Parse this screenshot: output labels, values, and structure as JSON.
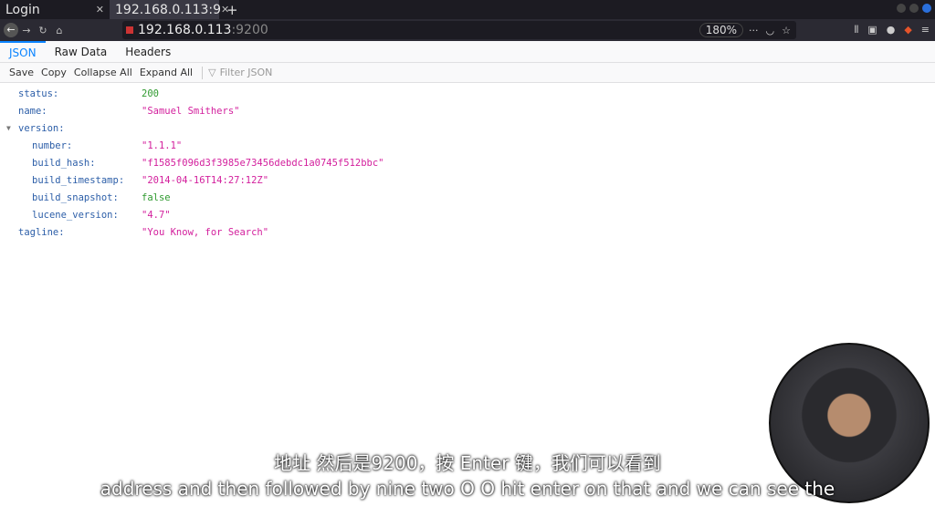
{
  "tabs": [
    {
      "label": "Login"
    },
    {
      "label": "192.168.0.113:9"
    }
  ],
  "new_tab": "+",
  "url": {
    "host": "192.168.0.113",
    "port": ":9200"
  },
  "zoom": "180%",
  "viewer_tabs": [
    "JSON",
    "Raw Data",
    "Headers"
  ],
  "toolbar": {
    "save": "Save",
    "copy": "Copy",
    "collapse": "Collapse All",
    "expand": "Expand All",
    "filter_placeholder": "Filter JSON"
  },
  "json": {
    "status": {
      "key": "status:",
      "value": "200"
    },
    "name": {
      "key": "name:",
      "value": "\"Samuel Smithers\""
    },
    "version": {
      "key": "version:"
    },
    "number": {
      "key": "number:",
      "value": "\"1.1.1\""
    },
    "build_hash": {
      "key": "build_hash:",
      "value": "\"f1585f096d3f3985e73456debdc1a0745f512bbc\""
    },
    "build_timestamp": {
      "key": "build_timestamp:",
      "value": "\"2014-04-16T14:27:12Z\""
    },
    "build_snapshot": {
      "key": "build_snapshot:",
      "value": "false"
    },
    "lucene_version": {
      "key": "lucene_version:",
      "value": "\"4.7\""
    },
    "tagline": {
      "key": "tagline:",
      "value": "\"You Know, for Search\""
    }
  },
  "subtitles": {
    "zh": "地址 然后是9200，按 Enter 键，我们可以看到",
    "en": "address and then followed by nine two O O hit enter on that and we can see the"
  }
}
